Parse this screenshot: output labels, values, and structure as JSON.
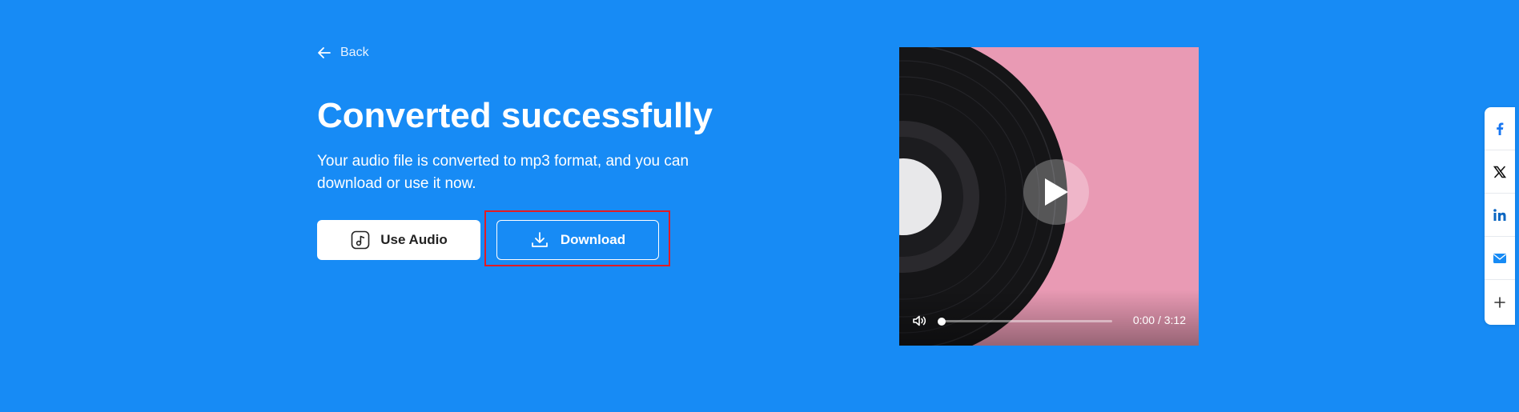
{
  "nav": {
    "back_label": "Back"
  },
  "hero": {
    "title": "Converted successfully",
    "description": "Your audio file is converted to mp3 format, and you can download or use it now."
  },
  "actions": {
    "use_audio_label": "Use Audio",
    "download_label": "Download"
  },
  "player": {
    "time_display": "0:00 / 3:12",
    "progress_fraction": 0.0,
    "icons": [
      "play-icon",
      "volume-icon"
    ]
  },
  "share": {
    "items": [
      {
        "name": "facebook",
        "icon": "facebook-icon",
        "color": "#1877F2"
      },
      {
        "name": "x",
        "icon": "x-icon",
        "color": "#000000"
      },
      {
        "name": "linkedin",
        "icon": "linkedin-icon",
        "color": "#0A66C2"
      },
      {
        "name": "email",
        "icon": "email-icon",
        "color": "#178BF5"
      },
      {
        "name": "more",
        "icon": "plus-icon",
        "color": "#333333"
      }
    ]
  },
  "colors": {
    "background": "#178BF5",
    "highlight_border": "#e31b23",
    "player_bg": "#E99AB4"
  }
}
